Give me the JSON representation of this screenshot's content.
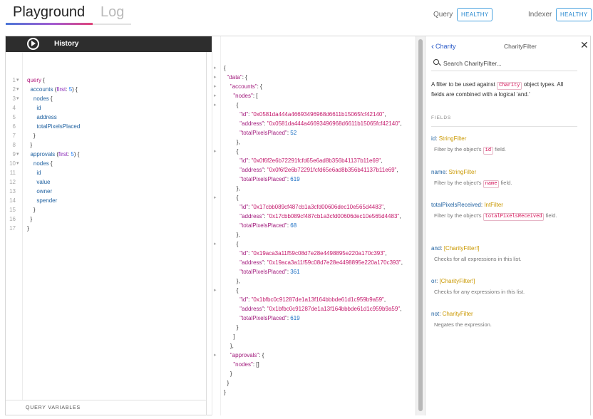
{
  "header": {
    "tabs": [
      {
        "label": "Playground",
        "active": true
      },
      {
        "label": "Log",
        "active": false
      }
    ],
    "statuses": [
      {
        "label": "Query",
        "badge": "HEALTHY"
      },
      {
        "label": "Indexer",
        "badge": "HEALTHY"
      }
    ],
    "accent_color": "#4aa3df"
  },
  "toolbar": {
    "run_icon": "play-circle-icon",
    "history_label": "History"
  },
  "query_editor": {
    "lines": [
      {
        "n": "1",
        "fold": true,
        "text": "query {"
      },
      {
        "n": "2",
        "fold": true,
        "text": "  accounts (first: 5) {"
      },
      {
        "n": "3",
        "fold": true,
        "text": "    nodes {"
      },
      {
        "n": "4",
        "fold": false,
        "text": "      id"
      },
      {
        "n": "5",
        "fold": false,
        "text": "      address"
      },
      {
        "n": "6",
        "fold": false,
        "text": "      totalPixelsPlaced"
      },
      {
        "n": "7",
        "fold": false,
        "text": "    }"
      },
      {
        "n": "8",
        "fold": false,
        "text": "  }"
      },
      {
        "n": "9",
        "fold": true,
        "text": "  approvals (first: 5) {"
      },
      {
        "n": "10",
        "fold": true,
        "text": "    nodes {"
      },
      {
        "n": "11",
        "fold": false,
        "text": "      id"
      },
      {
        "n": "12",
        "fold": false,
        "text": "      value"
      },
      {
        "n": "13",
        "fold": false,
        "text": "      owner"
      },
      {
        "n": "14",
        "fold": false,
        "text": "      spender"
      },
      {
        "n": "15",
        "fold": false,
        "text": "    }"
      },
      {
        "n": "16",
        "fold": false,
        "text": "  }"
      },
      {
        "n": "17",
        "fold": false,
        "text": "}"
      }
    ],
    "variables_label": "QUERY VARIABLES"
  },
  "result": {
    "lines": [
      {
        "fold": true,
        "text": "{"
      },
      {
        "fold": true,
        "text": "  \"data\": {"
      },
      {
        "fold": true,
        "text": "    \"accounts\": {"
      },
      {
        "fold": true,
        "text": "      \"nodes\": ["
      },
      {
        "fold": true,
        "text": "        {"
      },
      {
        "fold": false,
        "text": "          \"id\": \"0x0581da444a46693496968d6611b15065fcf42140\","
      },
      {
        "fold": false,
        "text": "          \"address\": \"0x0581da444a46693496968d6611b15065fcf42140\","
      },
      {
        "fold": false,
        "text": "          \"totalPixelsPlaced\": 52"
      },
      {
        "fold": false,
        "text": "        },"
      },
      {
        "fold": true,
        "text": "        {"
      },
      {
        "fold": false,
        "text": "          \"id\": \"0x0f6f2e6b72291fcfd65e6ad8b356b41137b11e69\","
      },
      {
        "fold": false,
        "text": "          \"address\": \"0x0f6f2e6b72291fcfd65e6ad8b356b41137b11e69\","
      },
      {
        "fold": false,
        "text": "          \"totalPixelsPlaced\": 619"
      },
      {
        "fold": false,
        "text": "        },"
      },
      {
        "fold": true,
        "text": "        {"
      },
      {
        "fold": false,
        "text": "          \"id\": \"0x17cbb089cf487cb1a3cfd00606dec10e565d4483\","
      },
      {
        "fold": false,
        "text": "          \"address\": \"0x17cbb089cf487cb1a3cfd00606dec10e565d4483\","
      },
      {
        "fold": false,
        "text": "          \"totalPixelsPlaced\": 68"
      },
      {
        "fold": false,
        "text": "        },"
      },
      {
        "fold": true,
        "text": "        {"
      },
      {
        "fold": false,
        "text": "          \"id\": \"0x19aca3a11f59c08d7e28e4498895e220a170c393\","
      },
      {
        "fold": false,
        "text": "          \"address\": \"0x19aca3a11f59c08d7e28e4498895e220a170c393\","
      },
      {
        "fold": false,
        "text": "          \"totalPixelsPlaced\": 361"
      },
      {
        "fold": false,
        "text": "        },"
      },
      {
        "fold": true,
        "text": "        {"
      },
      {
        "fold": false,
        "text": "          \"id\": \"0x1bfbc0c91287de1a13f164bbbde61d1c959b9a59\","
      },
      {
        "fold": false,
        "text": "          \"address\": \"0x1bfbc0c91287de1a13f164bbbde61d1c959b9a59\","
      },
      {
        "fold": false,
        "text": "          \"totalPixelsPlaced\": 619"
      },
      {
        "fold": false,
        "text": "        }"
      },
      {
        "fold": false,
        "text": "      ]"
      },
      {
        "fold": false,
        "text": "    },"
      },
      {
        "fold": true,
        "text": "    \"approvals\": {"
      },
      {
        "fold": false,
        "text": "      \"nodes\": []"
      },
      {
        "fold": false,
        "text": "    }"
      },
      {
        "fold": false,
        "text": "  }"
      },
      {
        "fold": false,
        "text": "}"
      }
    ]
  },
  "docs": {
    "back_label": "Charity",
    "title": "CharityFilter",
    "close_icon": "close-icon",
    "search_placeholder": "Search CharityFilter...",
    "description_pre": "A filter to be used against ",
    "description_chip": "Charity",
    "description_post": " object types. All fields are combined with a logical ‘and.’",
    "fields_header": "FIELDS",
    "fields": [
      {
        "name": "id",
        "type": "StringFilter",
        "desc_pre": "Filter by the object’s ",
        "desc_chip": "id",
        "desc_post": " field."
      },
      {
        "name": "name",
        "type": "StringFilter",
        "desc_pre": "Filter by the object’s ",
        "desc_chip": "name",
        "desc_post": " field."
      },
      {
        "name": "totalPixelsReceived",
        "type": "IntFilter",
        "desc_pre": "Filter by the object’s ",
        "desc_chip": "totalPixelsReceived",
        "desc_post": " field."
      },
      {
        "name": "and",
        "type": "[CharityFilter!]",
        "desc_pre": "Checks for all expressions in this list.",
        "desc_chip": "",
        "desc_post": ""
      },
      {
        "name": "or",
        "type": "[CharityFilter!]",
        "desc_pre": "Checks for any expressions in this list.",
        "desc_chip": "",
        "desc_post": ""
      },
      {
        "name": "not",
        "type": "CharityFilter",
        "desc_pre": "Negates the expression.",
        "desc_chip": "",
        "desc_post": ""
      }
    ]
  }
}
